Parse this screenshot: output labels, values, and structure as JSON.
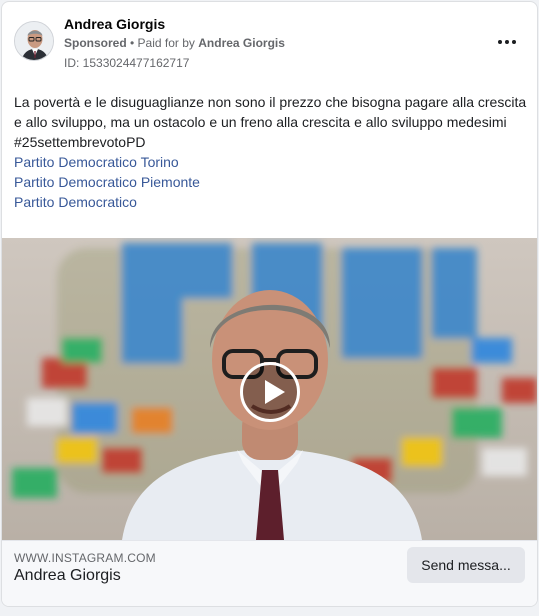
{
  "post": {
    "page_name": "Andrea Giorgis",
    "sponsored_label": "Sponsored",
    "separator": " • ",
    "paid_for_prefix": "Paid for by ",
    "paid_for_name": "Andrea Giorgis",
    "ad_id": "ID: 1533024477162717",
    "body": "La povertà e le disuguaglianze non sono il prezzo che bisogna pagare alla crescita e allo sviluppo, ma un ostacolo e un freno alla crescita e allo sviluppo medesimi",
    "hashtag": "#25settembrevotoPD",
    "links": [
      "Partito Democratico Torino",
      "Partito Democratico Piemonte",
      "Partito Democratico"
    ]
  },
  "media": {
    "type": "video",
    "play_icon": "play-icon"
  },
  "footer": {
    "domain": "WWW.INSTAGRAM.COM",
    "title": "Andrea Giorgis",
    "cta_label": "Send messa..."
  },
  "icons": {
    "more": "more-options-icon"
  },
  "colors": {
    "link": "#385898",
    "muted": "#65676b",
    "card_bg": "#ffffff",
    "footer_bg": "#f7f8fa"
  }
}
